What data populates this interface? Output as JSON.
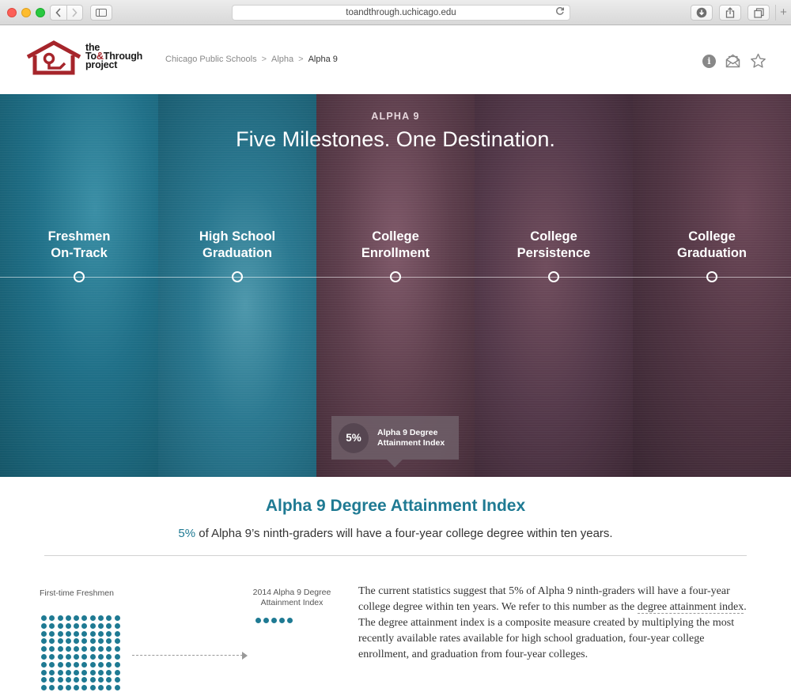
{
  "browser": {
    "url": "toandthrough.uchicago.edu",
    "new_tab": "+"
  },
  "header": {
    "logo": {
      "line1": "the",
      "line2_a": "To",
      "line2_amp": "&",
      "line2_b": "Through",
      "line3": "project"
    },
    "breadcrumb": [
      {
        "label": "Chicago Public Schools"
      },
      {
        "label": "Alpha"
      },
      {
        "label": "Alpha 9"
      }
    ],
    "breadcrumb_sep": ">",
    "info_glyph": "i"
  },
  "hero": {
    "label": "ALPHA 9",
    "title": "Five Milestones. One Destination.",
    "milestones": [
      {
        "line1": "Freshmen",
        "line2": "On-Track"
      },
      {
        "line1": "High School",
        "line2": "Graduation"
      },
      {
        "line1": "College",
        "line2": "Enrollment"
      },
      {
        "line1": "College",
        "line2": "Persistence"
      },
      {
        "line1": "College",
        "line2": "Graduation"
      }
    ],
    "index_badge": {
      "value": "5%",
      "line1": "Alpha 9 Degree",
      "line2": "Attainment Index"
    }
  },
  "attainment": {
    "title": "Alpha 9 Degree Attainment Index",
    "subtitle_pct": "5%",
    "subtitle_rest": " of Alpha 9’s ninth-graders will have a four-year college degree within ten years.",
    "freshmen_label": "First-time Freshmen",
    "index_label_line1": "2014 Alpha 9 Degree",
    "index_label_line2": "Attainment Index",
    "freshmen_dots_shown": 100,
    "index_dots": 5,
    "paragraph_a": "The current statistics suggest that 5% of Alpha 9 ninth-graders will have a four-year college degree within ten years. We refer to this number as the ",
    "paragraph_link": "degree attainment index",
    "paragraph_b": ". The degree attainment index is a composite measure created by multiplying the most recently available rates available for high school graduation, four-year college enrollment, and graduation from four-year colleges."
  },
  "colors": {
    "teal": "#1f7a93",
    "plum": "#5d3e4c",
    "logo_red": "#a6252b"
  },
  "icons": [
    "back-icon",
    "forward-icon",
    "sidebar-icon",
    "reload-icon",
    "download-icon",
    "share-icon",
    "tabs-icon",
    "info-icon",
    "mail-icon",
    "star-icon"
  ]
}
